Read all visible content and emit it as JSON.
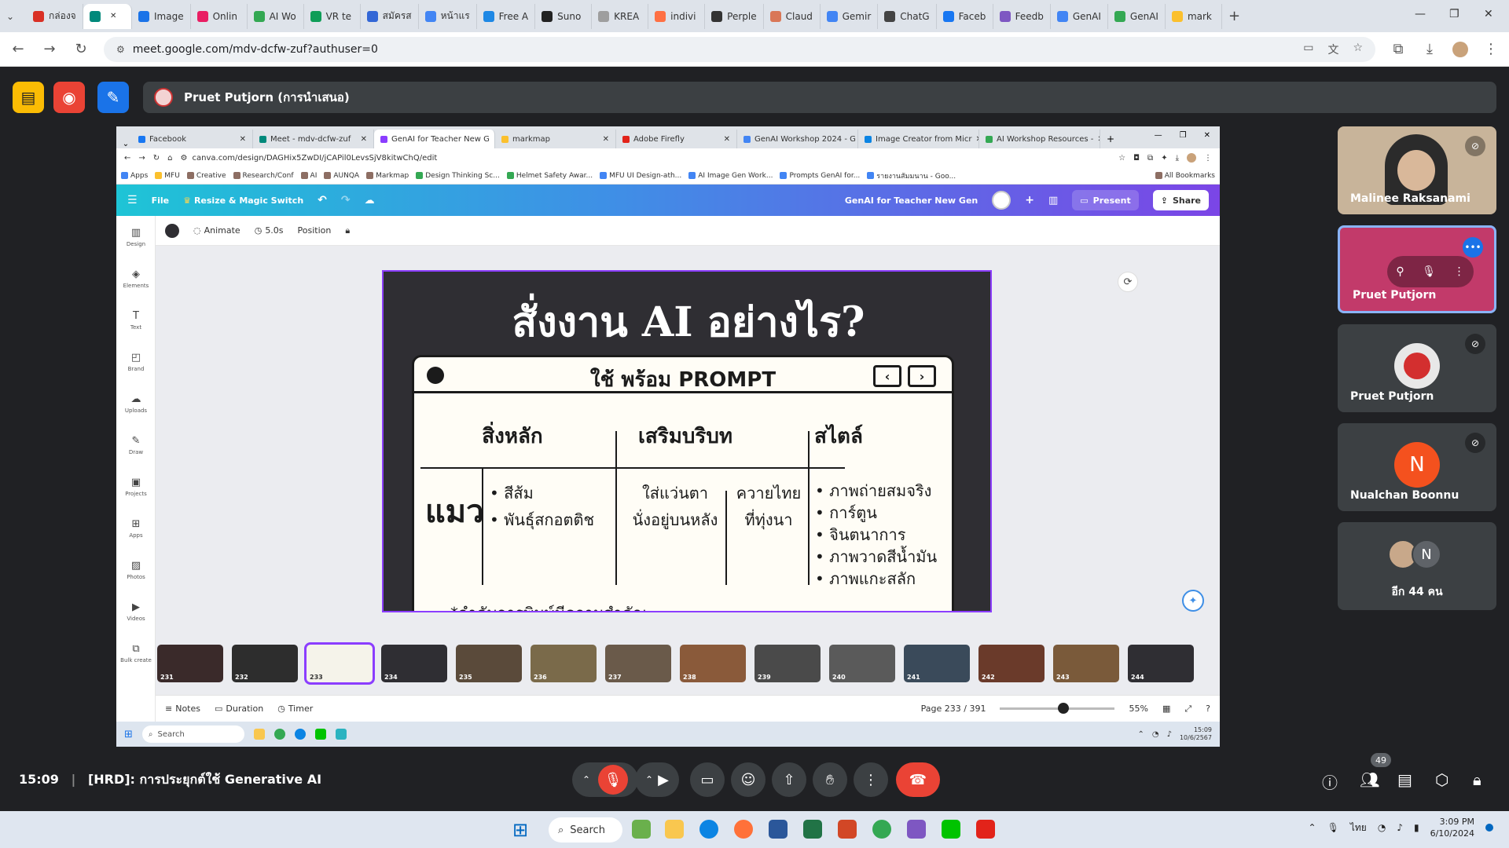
{
  "outer_browser": {
    "tabs": [
      {
        "label": "กล่องจ",
        "color": "#d93025"
      },
      {
        "label": "",
        "color": "#00897b"
      },
      {
        "label": "Image",
        "color": "#1a73e8"
      },
      {
        "label": "Onlin",
        "color": "#e91e63"
      },
      {
        "label": "AI Wo",
        "color": "#34a853"
      },
      {
        "label": "VR te",
        "color": "#0f9d58"
      },
      {
        "label": "สมัครส",
        "color": "#3367d6"
      },
      {
        "label": "หน้าแร",
        "color": "#4285f4"
      },
      {
        "label": "Free A",
        "color": "#1e88e5"
      },
      {
        "label": "Suno",
        "color": "#222222"
      },
      {
        "label": "KREA",
        "color": "#9e9e9e"
      },
      {
        "label": "indivi",
        "color": "#ff7043"
      },
      {
        "label": "Perple",
        "color": "#333333"
      },
      {
        "label": "Claud",
        "color": "#d97757"
      },
      {
        "label": "Gemir",
        "color": "#4285f4"
      },
      {
        "label": "ChatG",
        "color": "#444444"
      },
      {
        "label": "Faceb",
        "color": "#1877f2"
      },
      {
        "label": "Feedb",
        "color": "#7e57c2"
      },
      {
        "label": "GenAI",
        "color": "#4285f4"
      },
      {
        "label": "GenAI",
        "color": "#34a853"
      },
      {
        "label": "mark",
        "color": "#fbc02d"
      }
    ],
    "url": "meet.google.com/mdv-dcfw-zuf?authuser=0"
  },
  "meet": {
    "presenter_label": "Pruet Putjorn (การนำเสนอ)",
    "meeting_time": "15:09",
    "meeting_title": "[HRD]: การประยุกต์ใช้ Generative AI",
    "participant_count": "49",
    "participants": [
      {
        "name": "Malinee Raksanami",
        "type": "video"
      },
      {
        "name": "Pruet Putjorn",
        "type": "presenting"
      },
      {
        "name": "Pruet Putjorn",
        "type": "avatar"
      },
      {
        "name": "Nualchan Boonnu",
        "type": "initial",
        "initial": "N",
        "color": "#f4511e"
      }
    ],
    "others_label": "อีก 44 คน",
    "others_initial": "N"
  },
  "inner_browser": {
    "tabs": [
      "Facebook",
      "Meet - mdv-dcfw-zuf",
      "GenAI for Teacher New G",
      "markmap",
      "Adobe Firefly",
      "GenAI Workshop 2024 - G",
      "Image Creator from Micr",
      "AI Workshop Resources -"
    ],
    "url": "canva.com/design/DAGHix5ZwDI/jCAPil0LevsSjV8kitwChQ/edit",
    "bookmarks": [
      "Apps",
      "MFU",
      "Creative",
      "Research/Conf",
      "AI",
      "AUNQA",
      "Markmap",
      "Design Thinking Sc...",
      "Helmet Safety Awar...",
      "MFU UI Design-ath...",
      "AI Image Gen Work...",
      "Prompts GenAI for...",
      "รายงานสัมมนาน - Goo...",
      "All Bookmarks"
    ]
  },
  "canva": {
    "file_label": "File",
    "resize_label": "Resize & Magic Switch",
    "design_title": "GenAI for Teacher New Gen",
    "present_label": "Present",
    "share_label": "Share",
    "animate_label": "Animate",
    "duration_value": "5.0s",
    "position_label": "Position",
    "sidebar": [
      "Design",
      "Elements",
      "Text",
      "Brand",
      "Uploads",
      "Draw",
      "Projects",
      "Apps",
      "Photos",
      "Videos",
      "Bulk create"
    ],
    "notes_label": "Notes",
    "duration_label": "Duration",
    "timer_label": "Timer",
    "page_label": "Page 233 / 391",
    "zoom_label": "55%",
    "zoom_fraction": 0.55,
    "thumbnails": [
      {
        "num": "231",
        "color": "#3a2a2a"
      },
      {
        "num": "232",
        "color": "#2d2d2d"
      },
      {
        "num": "233",
        "color": "#f5f3ea",
        "selected": true
      },
      {
        "num": "234",
        "color": "#2f2e33"
      },
      {
        "num": "235",
        "color": "#5a4a3a"
      },
      {
        "num": "236",
        "color": "#7a6a4a"
      },
      {
        "num": "237",
        "color": "#6a5a4a"
      },
      {
        "num": "238",
        "color": "#8a5a3a"
      },
      {
        "num": "239",
        "color": "#4a4a4a"
      },
      {
        "num": "240",
        "color": "#5a5a5a"
      },
      {
        "num": "241",
        "color": "#3a4a5a"
      },
      {
        "num": "242",
        "color": "#6a3a2a"
      },
      {
        "num": "243",
        "color": "#7a5a3a"
      },
      {
        "num": "244",
        "color": "#2f2e33"
      }
    ]
  },
  "slide": {
    "title": "สั่งงาน AI อย่างไร?",
    "window_title": "ใช้ พร้อม PROMPT",
    "col_main": "สิ่งหลัก",
    "col_context": "เสริมบริบท",
    "col_style": "สไตล์",
    "subject": "แมว",
    "subject_details": [
      "• สีส้ม",
      "• พันธุ์สกอตติช"
    ],
    "context_1": [
      "ใส่แว่นตา",
      "นั่งอยู่บนหลัง"
    ],
    "context_2": [
      "ควายไทย",
      "ที่ทุ่งนา"
    ],
    "styles": [
      "• ภาพถ่ายสมจริง",
      "• การ์ตูน",
      "• จินตนาการ",
      "• ภาพวาดสีน้ำมัน",
      "• ภาพแกะสลัก"
    ],
    "note": "*ลำดับการพิมพ์มีความสำคัญ"
  },
  "inner_taskbar": {
    "search_placeholder": "Search",
    "time": "15:09",
    "date": "10/6/2567"
  },
  "windows_taskbar": {
    "search_label": "Search",
    "time": "3:09 PM",
    "date": "6/10/2024",
    "lang": "ไทย"
  }
}
